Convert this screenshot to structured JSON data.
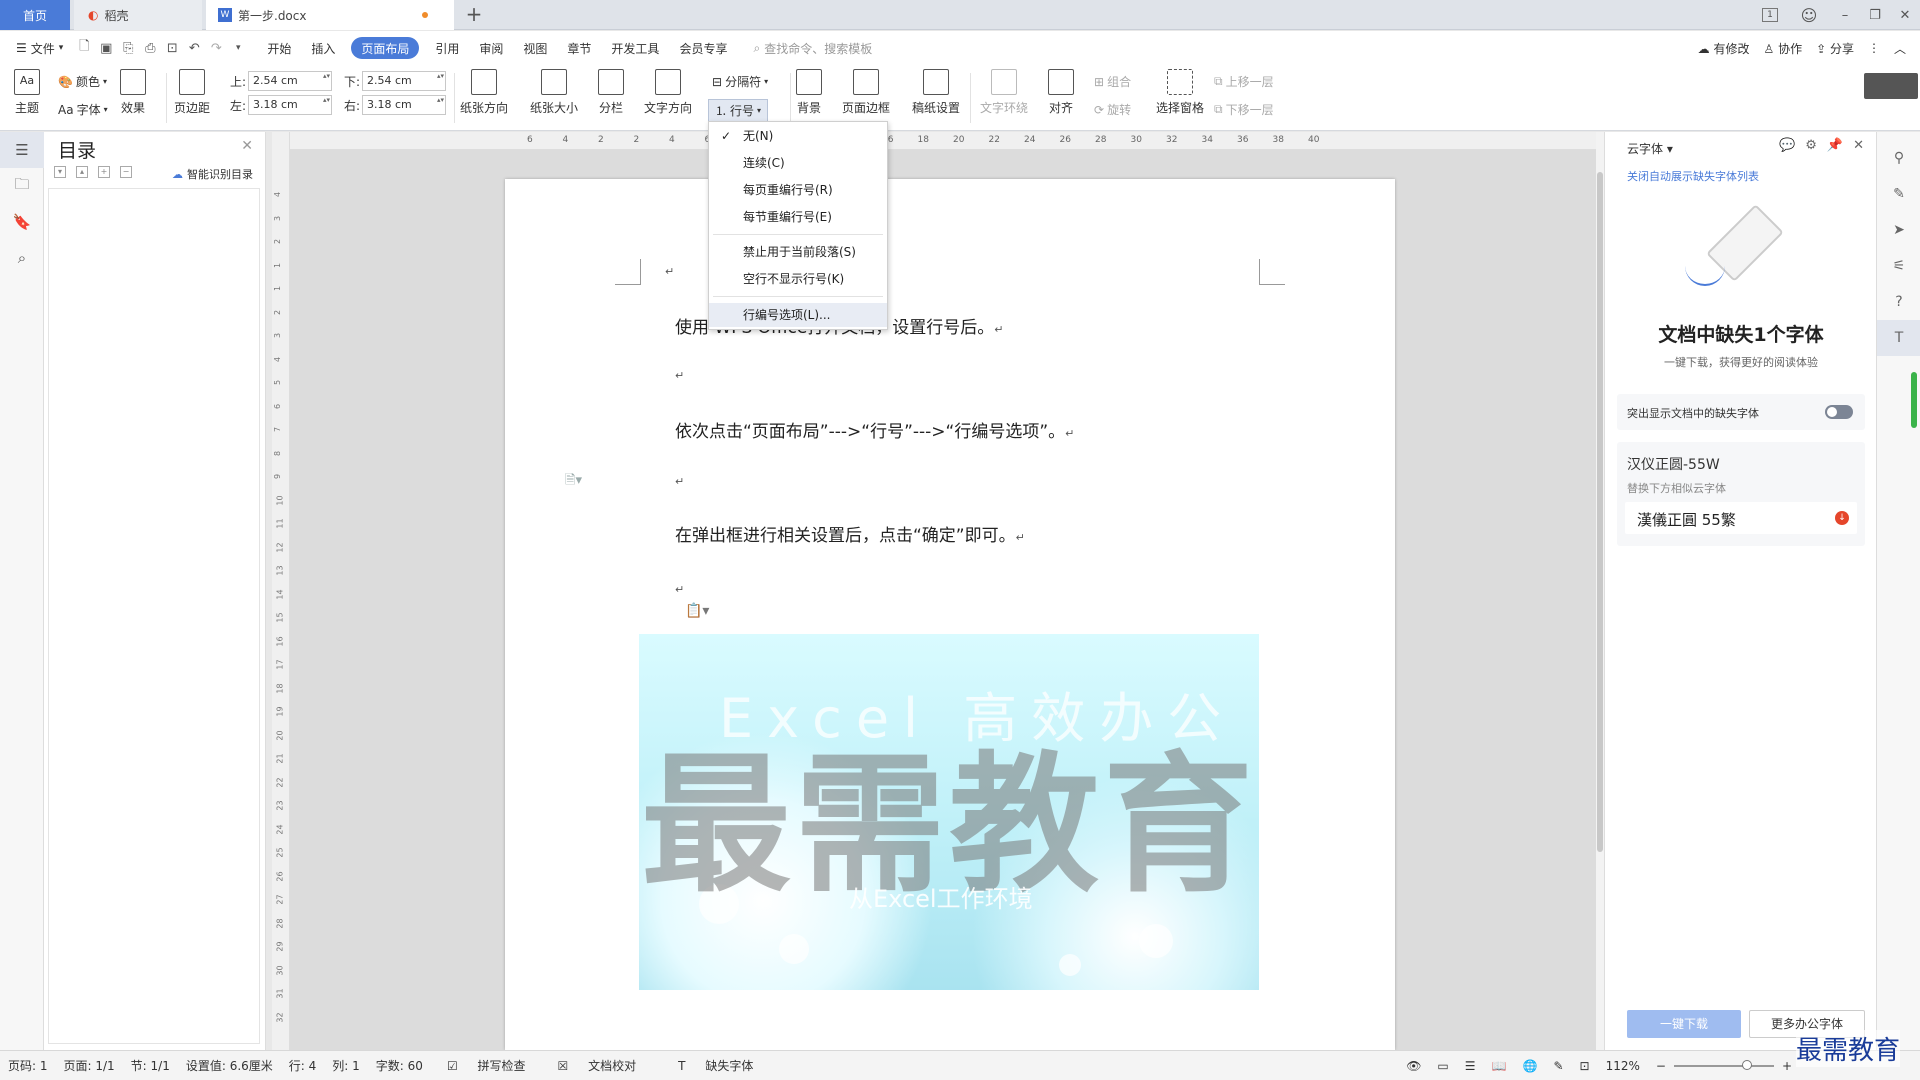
{
  "tabs": {
    "home": "首页",
    "daoke": "稻壳",
    "doc": "第一步.docx",
    "add": "+"
  },
  "window": {
    "page_icon": "1",
    "min": "–",
    "restore": "❐",
    "close": "✕"
  },
  "menu": {
    "file": "文件",
    "items": [
      "开始",
      "插入",
      "页面布局",
      "引用",
      "审阅",
      "视图",
      "章节",
      "开发工具",
      "会员专享"
    ],
    "search_placeholder": "查找命令、搜索模板",
    "modified": "有修改",
    "collab": "协作",
    "share": "分享"
  },
  "ribbon": {
    "theme": "主题",
    "color": "颜色",
    "font": "字体",
    "effect": "效果",
    "margin": "页边距",
    "top_label": "上:",
    "top_value": "2.54 cm",
    "bottom_label": "下:",
    "bottom_value": "2.54 cm",
    "left_label": "左:",
    "left_value": "3.18 cm",
    "right_label": "右:",
    "right_value": "3.18 cm",
    "orientation": "纸张方向",
    "size": "纸张大小",
    "columns": "分栏",
    "text_dir": "文字方向",
    "breaks": "分隔符",
    "line_numbers": "行号",
    "background": "背景",
    "page_border": "页面边框",
    "grid_paper": "稿纸设置",
    "wrap": "文字环绕",
    "align": "对齐",
    "group": "组合",
    "rotate": "旋转",
    "select_pane": "选择窗格",
    "bring_forward": "上移一层",
    "send_backward": "下移一层"
  },
  "dropdown": {
    "items": [
      "无(N)",
      "连续(C)",
      "每页重编行号(R)",
      "每节重编行号(E)",
      "禁止用于当前段落(S)",
      "空行不显示行号(K)",
      "行编号选项(L)..."
    ]
  },
  "toc": {
    "title": "目录",
    "smart": "智能识别目录"
  },
  "ruler_h": [
    "6",
    "4",
    "2",
    "2",
    "4",
    "6",
    "8",
    "10",
    "12",
    "14",
    "16",
    "18",
    "20",
    "22",
    "24",
    "26",
    "28",
    "30",
    "32",
    "34",
    "36",
    "38",
    "40"
  ],
  "ruler_v": [
    "4",
    "3",
    "2",
    "1",
    "1",
    "2",
    "3",
    "4",
    "5",
    "6",
    "7",
    "8",
    "9",
    "10",
    "11",
    "12",
    "13",
    "14",
    "15",
    "16",
    "17",
    "18",
    "19",
    "20",
    "21",
    "22",
    "23",
    "24",
    "25",
    "26",
    "27",
    "28",
    "29",
    "30",
    "31",
    "32"
  ],
  "document": {
    "para_mark": "↵",
    "line1": "使用 WPS Office打开文档，设置行号后。",
    "line2": "依次点击“页面布局”--->“行号”--->“行编号选项”。",
    "line3": "在弹出框进行相关设置后，点击“确定”即可。",
    "hero_title": "Excel 高效办公",
    "hero_watermark": "最需教育",
    "hero_sub": "从Excel工作环境"
  },
  "rpanel": {
    "header": "云字体",
    "close_link": "关闭自动展示缺失字体列表",
    "heading": "文档中缺失1个字体",
    "sub": "一键下载，获得更好的阅读体验",
    "toggle_label": "突出显示文档中的缺失字体",
    "font_name": "汉仪正圆-55W",
    "replace_hint": "替换下方相似云字体",
    "font_preview": "漢儀正圓 55繁",
    "download_btn": "一键下载",
    "more_btn": "更多办公字体"
  },
  "status": {
    "page_code": "页码: 1",
    "page": "页面: 1/1",
    "section": "节: 1/1",
    "setting": "设置值: 6.6厘米",
    "row": "行: 4",
    "col": "列: 1",
    "words": "字数: 60",
    "spell": "拼写检查",
    "proof": "文档校对",
    "missing_font": "缺失字体",
    "zoom": "112%"
  },
  "corner_logo": "最需教育",
  "colors": {
    "accent": "#4a7bd8",
    "tab_dot": "#f08c2b"
  }
}
